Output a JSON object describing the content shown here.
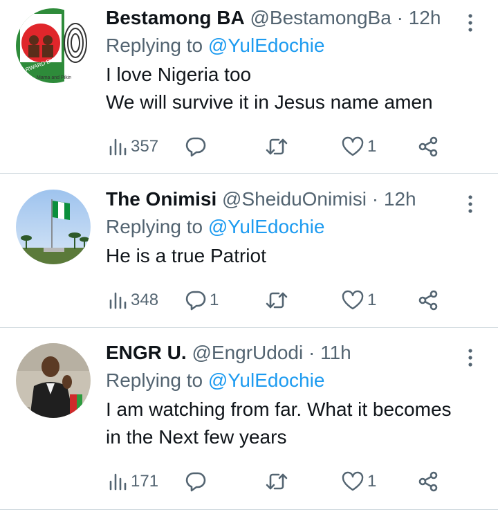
{
  "tweets": [
    {
      "name": "Bestamong BA",
      "handle": "@BestamongBa",
      "separator": "·",
      "time": "12h",
      "replying_prefix": "Replying to",
      "replying_to": "@YulEdochie",
      "body_lines": [
        "I love Nigeria too",
        "We will survive it in Jesus name amen"
      ],
      "avatar_text": {
        "logo": "L P",
        "ribbon": "RWARD EVER",
        "caption": "Mama and Pikin"
      },
      "views": "357",
      "replies": "",
      "retweets": "",
      "likes": "1"
    },
    {
      "name": "The Onimisi",
      "handle": "@SheiduOnimisi",
      "separator": "·",
      "time": "12h",
      "replying_prefix": "Replying to",
      "replying_to": "@YulEdochie",
      "body_lines": [
        "He is a true Patriot"
      ],
      "views": "348",
      "replies": "1",
      "retweets": "",
      "likes": "1"
    },
    {
      "name": "ENGR U.",
      "handle": "@EngrUdodi",
      "separator": "·",
      "time": "11h",
      "replying_prefix": "Replying to",
      "replying_to": "@YulEdochie",
      "body_lines": [
        "I am watching from far. What it becomes",
        "in the Next few years"
      ],
      "views": "171",
      "replies": "",
      "retweets": "",
      "likes": "1"
    }
  ],
  "colors": {
    "text": "#0f1419",
    "secondary": "#536471",
    "link": "#1d9bf0",
    "divider": "#cfd9de"
  },
  "icons": [
    "views-icon",
    "reply-icon",
    "retweet-icon",
    "like-icon",
    "share-icon",
    "more-icon"
  ]
}
